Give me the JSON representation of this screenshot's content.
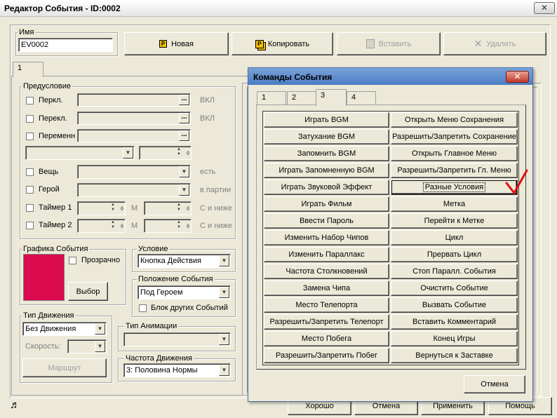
{
  "window": {
    "title": "Редактор События - ID:0002",
    "close": "✕"
  },
  "name_group": {
    "label": "Имя",
    "value": "EV0002"
  },
  "toolbar": {
    "new": "Новая",
    "copy": "Копировать",
    "paste": "Вставить",
    "delete": "Удалить"
  },
  "page_tab": "1",
  "precondition": {
    "label": "Предусловие",
    "switch1": {
      "label": "Перкл.",
      "suffix": "ВКЛ"
    },
    "switch2": {
      "label": "Перекл.",
      "suffix": "ВКЛ"
    },
    "variable": {
      "label": "Переменн"
    },
    "item": {
      "label": "Вещь",
      "suffix": "есть"
    },
    "hero": {
      "label": "Герой",
      "suffix": "в партии"
    },
    "timer1": {
      "label": "Таймер 1",
      "unit": "М",
      "suffix": "С и ниже"
    },
    "timer2": {
      "label": "Таймер 2",
      "unit": "М",
      "suffix": "С и ниже"
    }
  },
  "graphic": {
    "label": "Графика События",
    "transparent": "Прозрачно",
    "select": "Выбор",
    "color": "#dc0a4e"
  },
  "condition": {
    "label": "Условие",
    "value": "Кнопка Действия"
  },
  "position": {
    "label": "Положение События",
    "value": "Под Героем",
    "block_label": "Блок других Событий"
  },
  "movement": {
    "label": "Тип Движения",
    "value": "Без Движения",
    "speed_label": "Скорость:",
    "route": "Маршрут"
  },
  "animation": {
    "label": "Тип Анимации"
  },
  "frequency": {
    "label": "Частота Движения",
    "value": "3: Половина Нормы"
  },
  "footer": {
    "ok": "Хорошо",
    "cancel": "Отмена",
    "apply": "Применить",
    "help": "Помощь"
  },
  "commands": {
    "title": "Команды События",
    "close": "✕",
    "tabs": [
      "1",
      "2",
      "3",
      "4"
    ],
    "left": [
      "Играть BGM",
      "Затухание BGM",
      "Запомнить BGM",
      "Играть Запомненную BGM",
      "Играть Звуковой Эффект",
      "Играть Фильм",
      "Ввести Пароль",
      "Изменить Набор Чипов",
      "Изменить Параллакс",
      "Частота Столкновений",
      "Замена Чипа",
      "Место Телепорта",
      "Разрешить/Запретить Телепорт",
      "Место Побега",
      "Разрешить/Запретить Побег"
    ],
    "right": [
      "Открыть Меню Сохранения",
      "Разрешить/Запретить Сохранение",
      "Открыть Главное Меню",
      "Разрешить/Запретить Гл. Меню",
      "Разные Условия",
      "Метка",
      "Перейти к Метке",
      "Цикл",
      "Прервать Цикл",
      "Стоп Паралл. События",
      "Очистить Событие",
      "Вызвать Событие",
      "Вставить Комментарий",
      "Конец Игры",
      "Вернуться к Заставке"
    ],
    "cancel": "Отмена",
    "checkmark_color": "#e01010"
  }
}
